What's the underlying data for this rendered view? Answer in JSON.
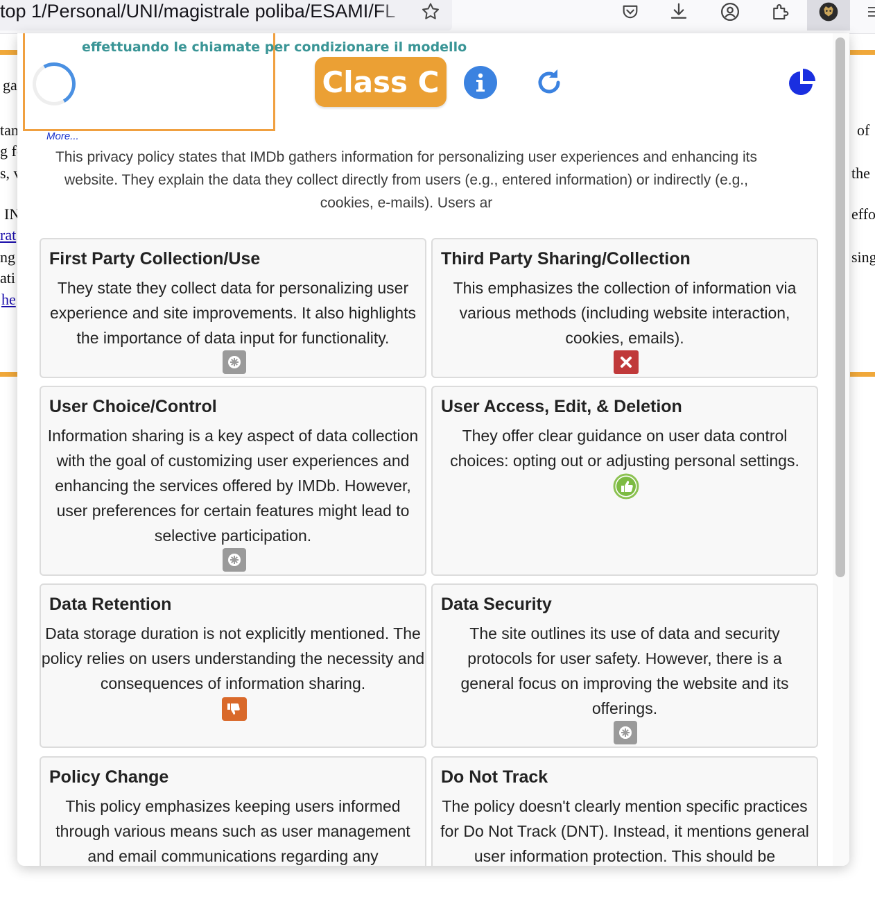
{
  "browser": {
    "url": "top 1/Personal/UNI/magistrale poliba/ESAMI/FL",
    "toolbar_icons": [
      "star-icon",
      "pocket-icon",
      "download-icon",
      "account-icon",
      "extensions-icon",
      "extension-active-icon",
      "menu-icon"
    ]
  },
  "background_page": {
    "left_fragments": [
      "ga",
      "tan",
      "g fo",
      "s, v",
      "IN",
      "rat",
      "ng",
      "ati",
      "he"
    ],
    "right_fragments": [
      "of",
      "the",
      "effor",
      "sing"
    ],
    "accent_color": "#f0a83a"
  },
  "popup": {
    "status_text": "effettuando le chiamate per condizionare il modello",
    "class_label": "Class C",
    "class_color": "#eba034",
    "info_icon": "info-icon",
    "refresh_icon": "refresh-icon",
    "chart_icon": "pie-chart-icon",
    "more_label": "More...",
    "summary": "This privacy policy states that IMDb gathers information for personalizing user experiences and enhancing its website. They explain the data they collect directly from users (e.g., entered information) or indirectly (e.g., cookies, e-mails). Users ar",
    "cards": [
      {
        "title": "First Party Collection/Use",
        "body": "They state they collect data for personalizing user experience and site improvements. It also highlights the importance of data input for functionality.",
        "rating": "neutral",
        "icon": "neutral-asterisk-icon"
      },
      {
        "title": "Third Party Sharing/Collection",
        "body": "This emphasizes the collection of information via various methods (including website interaction, cookies, emails).",
        "rating": "bad",
        "icon": "red-x-icon"
      },
      {
        "title": "User Choice/Control",
        "body": "Information sharing is a key aspect of data collection with the goal of customizing user experiences and enhancing the services offered by IMDb. However, user preferences for certain features might lead to selective participation.",
        "rating": "neutral",
        "icon": "neutral-asterisk-icon"
      },
      {
        "title": "User Access, Edit, & Deletion",
        "body": "They offer clear guidance on user data control choices: opting out or adjusting personal settings.",
        "rating": "good",
        "icon": "thumbs-up-icon"
      },
      {
        "title": "Data Retention",
        "body": "Data storage duration is not explicitly mentioned. The policy relies on users understanding the necessity and consequences of information sharing.",
        "rating": "negative",
        "icon": "thumbs-down-icon"
      },
      {
        "title": "Data Security",
        "body": "The site outlines its use of data and security protocols for user safety. However, there is a general focus on improving the website and its offerings.",
        "rating": "neutral",
        "icon": "neutral-asterisk-icon"
      },
      {
        "title": "Policy Change",
        "body": "This policy emphasizes keeping users informed through various means such as user management and email communications regarding any",
        "rating": "",
        "icon": ""
      },
      {
        "title": "Do Not Track",
        "body": "The policy doesn't clearly mention specific practices for Do Not Track (DNT). Instead, it mentions general user information protection. This should be",
        "rating": "",
        "icon": ""
      }
    ]
  }
}
